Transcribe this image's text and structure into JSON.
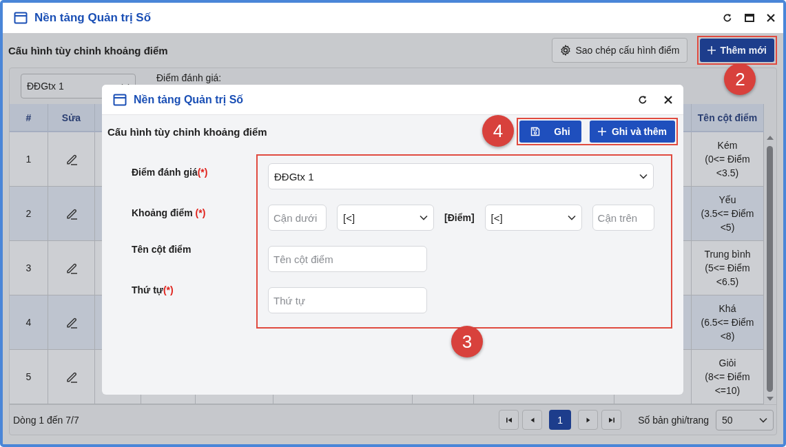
{
  "window": {
    "title": "Nền tảng Quản trị Số"
  },
  "page": {
    "heading": "Cấu hình tùy chỉnh khoảng điểm",
    "buttons": [
      {
        "kind": "copy",
        "label": "Sao chép cấu hình điểm"
      },
      {
        "kind": "add",
        "label": "Thêm mới",
        "highlight": {
          "number": "2"
        }
      }
    ]
  },
  "filter": {
    "select_value": "ĐĐGtx 1",
    "label": "Điểm đánh giá:"
  },
  "table": {
    "columns": [
      {
        "label": "#"
      },
      {
        "label": "Sửa"
      },
      {
        "label": "Tên cột điểm"
      }
    ],
    "rows": [
      {
        "number": "1",
        "name": "Kém\n(0<= Điểm\n<3.5)"
      },
      {
        "number": "2",
        "name": "Yếu\n(3.5<= Điểm\n<5)"
      },
      {
        "number": "3",
        "name": "Trung bình\n(5<= Điểm\n<6.5)"
      },
      {
        "number": "4",
        "name": "Khá\n(6.5<= Điểm\n<8)"
      },
      {
        "number": "5",
        "name": "Giỏi\n(8<= Điểm\n<=10)"
      }
    ]
  },
  "footer": {
    "summary": "Dòng 1 đến 7/7",
    "pages": [
      {
        "label": "1",
        "selected": true
      }
    ],
    "page_size_label": "Số bản ghi/trang",
    "page_size": "50"
  },
  "dialog": {
    "title": "Nền tảng Quản trị Số",
    "heading": "Cấu hình tùy chỉnh khoảng điểm",
    "actions": {
      "highlight": {
        "number": "4"
      },
      "buttons": [
        {
          "kind": "save",
          "label": "Ghi"
        },
        {
          "kind": "save_add",
          "label": "Ghi và thêm"
        }
      ]
    },
    "form": {
      "highlight": {
        "number": "3"
      },
      "fields": [
        {
          "kind": "select",
          "label": "Điểm đánh giá",
          "mark": "(*)",
          "value": "ĐĐGtx 1"
        },
        {
          "kind": "range",
          "label": "Khoảng điểm ",
          "mark": "(*)",
          "lower": {
            "placeholder": "Cận dưới"
          },
          "lower_operator": "[<]",
          "variable": "[Điểm]",
          "upper_operator": "[<]",
          "upper": {
            "placeholder": "Cận trên"
          }
        },
        {
          "kind": "text",
          "label": "Tên cột điểm",
          "placeholder": "Tên cột điểm"
        },
        {
          "kind": "text",
          "label": "Thứ tự",
          "mark": "(*)",
          "placeholder": "Thứ tự"
        }
      ]
    }
  }
}
